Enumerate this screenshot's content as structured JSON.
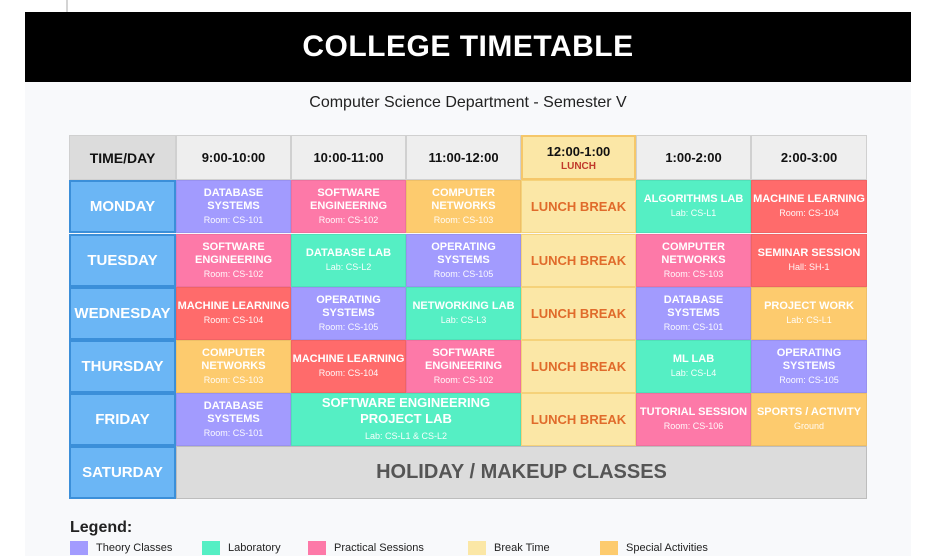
{
  "title": "COLLEGE TIMETABLE",
  "subtitle": "Computer Science Department - Semester V",
  "rail_icons": [
    "chat-icon",
    "shapes-icon"
  ],
  "header": {
    "corner": "TIME/DAY",
    "slots": [
      "9:00-10:00",
      "10:00-11:00",
      "11:00-12:00",
      "12:00-1:00",
      "1:00-2:00",
      "2:00-3:00"
    ],
    "lunch_sub": "LUNCH"
  },
  "days": [
    "MONDAY",
    "TUESDAY",
    "WEDNESDAY",
    "THURSDAY",
    "FRIDAY",
    "SATURDAY"
  ],
  "lunch_break": "LUNCH BREAK",
  "holiday": "HOLIDAY / MAKEUP CLASSES",
  "rows": [
    [
      {
        "title": "DATABASE SYSTEMS",
        "room": "Room: CS-101",
        "kind": "theory"
      },
      {
        "title": "SOFTWARE ENGINEERING",
        "room": "Room: CS-102",
        "kind": "prac"
      },
      {
        "title": "COMPUTER NETWORKS",
        "room": "Room: CS-103",
        "kind": "spec"
      },
      null,
      {
        "title": "ALGORITHMS LAB",
        "room": "Lab: CS-L1",
        "kind": "lab"
      },
      {
        "title": "MACHINE LEARNING",
        "room": "Room: CS-104",
        "kind": "red"
      }
    ],
    [
      {
        "title": "SOFTWARE ENGINEERING",
        "room": "Room: CS-102",
        "kind": "prac"
      },
      {
        "title": "DATABASE LAB",
        "room": "Lab: CS-L2",
        "kind": "lab"
      },
      {
        "title": "OPERATING SYSTEMS",
        "room": "Room: CS-105",
        "kind": "theory"
      },
      null,
      {
        "title": "COMPUTER NETWORKS",
        "room": "Room: CS-103",
        "kind": "prac"
      },
      {
        "title": "SEMINAR SESSION",
        "room": "Hall: SH-1",
        "kind": "red"
      }
    ],
    [
      {
        "title": "MACHINE LEARNING",
        "room": "Room: CS-104",
        "kind": "red"
      },
      {
        "title": "OPERATING SYSTEMS",
        "room": "Room: CS-105",
        "kind": "theory"
      },
      {
        "title": "NETWORKING LAB",
        "room": "Lab: CS-L3",
        "kind": "lab"
      },
      null,
      {
        "title": "DATABASE SYSTEMS",
        "room": "Room: CS-101",
        "kind": "theory"
      },
      {
        "title": "PROJECT WORK",
        "room": "Lab: CS-L1",
        "kind": "spec"
      }
    ],
    [
      {
        "title": "COMPUTER NETWORKS",
        "room": "Room: CS-103",
        "kind": "spec"
      },
      {
        "title": "MACHINE LEARNING",
        "room": "Room: CS-104",
        "kind": "red"
      },
      {
        "title": "SOFTWARE ENGINEERING",
        "room": "Room: CS-102",
        "kind": "prac"
      },
      null,
      {
        "title": "ML LAB",
        "room": "Lab: CS-L4",
        "kind": "lab"
      },
      {
        "title": "OPERATING SYSTEMS",
        "room": "Room: CS-105",
        "kind": "theory"
      }
    ]
  ],
  "friday": {
    "first": {
      "title": "DATABASE SYSTEMS",
      "room": "Room: CS-101",
      "kind": "theory"
    },
    "project_lab": {
      "title": "SOFTWARE ENGINEERING PROJECT LAB",
      "room": "Lab: CS-L1 & CS-L2",
      "kind": "lab"
    },
    "tutorial": {
      "title": "TUTORIAL SESSION",
      "room": "Room: CS-106",
      "kind": "prac"
    },
    "sports": {
      "title": "SPORTS / ACTIVITY",
      "room": "Ground",
      "kind": "spec"
    }
  },
  "legend": {
    "title": "Legend:",
    "items": [
      {
        "label": "Theory Classes",
        "color": "#a29bfe"
      },
      {
        "label": "Laboratory",
        "color": "#55efc4"
      },
      {
        "label": "Practical Sessions",
        "color": "#fd79a8"
      },
      {
        "label": "Break Time",
        "color": "#fbe7a6"
      },
      {
        "label": "Special Activities",
        "color": "#fdcb6e"
      }
    ]
  }
}
